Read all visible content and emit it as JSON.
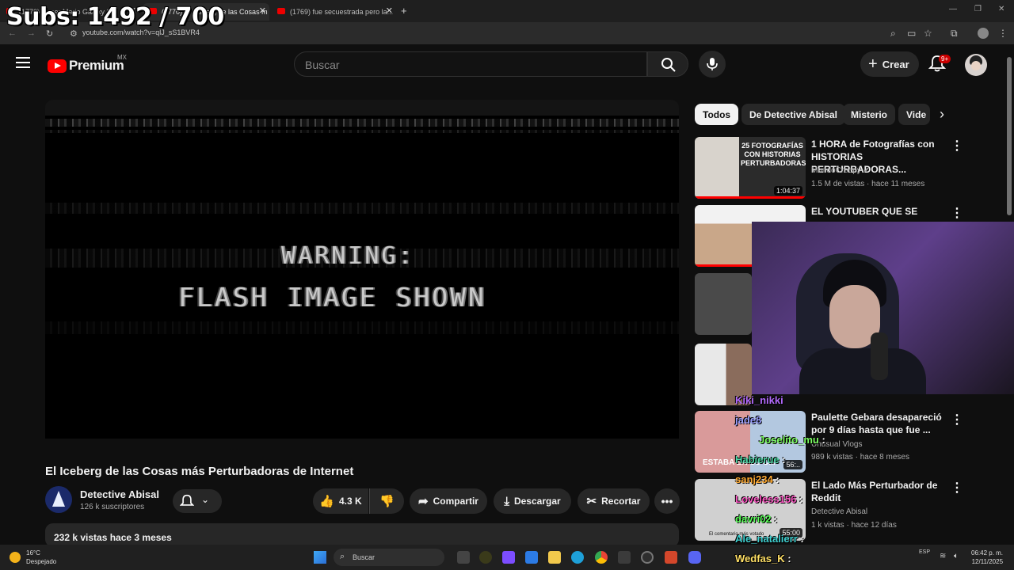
{
  "overlay": {
    "subs_counter": "Subs: 1492 / 700"
  },
  "browser": {
    "tabs": [
      {
        "label": "(1770) Super Mario Galaxy 2"
      },
      {
        "label": "(1770) El Iceberg de las Cosas m"
      },
      {
        "label": "(1769) fue secuestrada pero la..."
      }
    ],
    "url": "youtube.com/watch?v=qlJ_sS1BVR4"
  },
  "header": {
    "brand": "Premium",
    "country": "MX",
    "search_placeholder": "Buscar",
    "create_label": "Crear",
    "notifications_badge": "9+"
  },
  "video": {
    "warning_line1": "WARNING:",
    "warning_line2": "FLASH IMAGE SHOWN",
    "title": "El Iceberg de las Cosas más Perturbadoras de Internet",
    "channel": "Detective Abisal",
    "subscribers": "126 k suscriptores",
    "likes": "4.3 K",
    "share_label": "Compartir",
    "download_label": "Descargar",
    "clip_label": "Recortar",
    "views_date": "232 k vistas  hace 3 meses"
  },
  "chips": [
    {
      "label": "Todos"
    },
    {
      "label": "De Detective Abisal"
    },
    {
      "label": "Misterio"
    },
    {
      "label": "Vide"
    }
  ],
  "recommendations": [
    {
      "title": "1 HORA de Fotografías con HISTORIAS PERTURBADORAS...",
      "channel": "MundoCreepy",
      "meta": "1.5 M de vistas · hace 11 meses",
      "duration": "1:04:37",
      "thumb_text": "25 FOTOGRAFÍAS CON HISTORIAS PERTURBADORAS"
    },
    {
      "title": "EL YOUTUBER QUE SE",
      "channel": "",
      "meta": "",
      "duration": ""
    },
    {
      "title": "Paulette Gebara desapareció por 9 días hasta que fue ...",
      "channel": "Unusual Vlogs",
      "meta": "989 k vistas · hace 8 meses",
      "duration": "56:..",
      "thumb_text": "ESTABA EN SU C..."
    },
    {
      "title": "El Lado Más Perturbador de Reddit",
      "channel": "Detective Abisal",
      "meta": "1 k vistas · hace 12 días",
      "duration": "55:00",
      "thumb_text": "El comentario más votado"
    }
  ],
  "chat": [
    {
      "user": "Kiki_nikki",
      "color": "#b46bff",
      "msg": ""
    },
    {
      "user": "jade8",
      "color": "#9aa0ff",
      "msg": ""
    },
    {
      "user": "Joselito_mu",
      "color": "#7dff62",
      "msg": ":"
    },
    {
      "user": "Habierue",
      "color": "#4fd8a8",
      "msg": ":"
    },
    {
      "user": "sanj234",
      "color": "#ffaa33",
      "msg": ":"
    },
    {
      "user": "Loveless156",
      "color": "#ff5cc8",
      "msg": ":"
    },
    {
      "user": "davri02",
      "color": "#5cff5c",
      "msg": ":"
    },
    {
      "user": "Ale_natalierr",
      "color": "#3fd0d0",
      "msg": ":"
    },
    {
      "user": "Wedfas_K",
      "color": "#ffe066",
      "msg": ":"
    }
  ],
  "taskbar": {
    "temperature": "16°C",
    "weather": "Despejado",
    "search_label": "Buscar",
    "language": "ESP",
    "time": "06:42 p. m.",
    "date": "12/11/2025"
  },
  "colors": {
    "accent": "#ff0000",
    "background": "#0f0f0f",
    "surface": "#272727"
  }
}
